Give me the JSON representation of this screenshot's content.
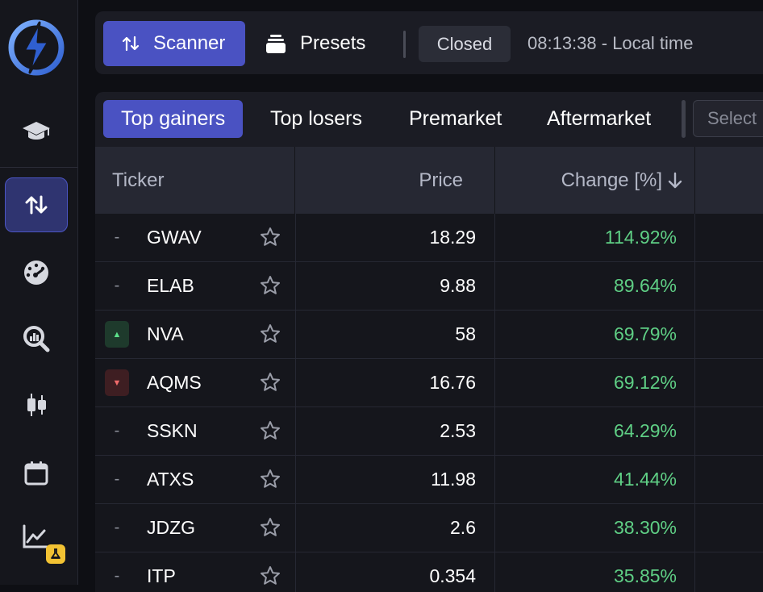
{
  "sidebar": {
    "items": [
      {
        "name": "academy",
        "icon": "graduation-cap-icon",
        "active": false
      },
      {
        "name": "scanner",
        "icon": "sort-arrows-icon",
        "active": true
      },
      {
        "name": "dashboard",
        "icon": "gauge-icon",
        "active": false
      },
      {
        "name": "research",
        "icon": "magnify-chart-icon",
        "active": false
      },
      {
        "name": "charts",
        "icon": "candlestick-icon",
        "active": false
      },
      {
        "name": "calendar",
        "icon": "calendar-icon",
        "active": false
      },
      {
        "name": "lab",
        "icon": "line-chart-icon",
        "active": false,
        "badge": "flask-icon"
      }
    ]
  },
  "topbar": {
    "scanner_label": "Scanner",
    "presets_label": "Presets",
    "market_status": "Closed",
    "local_time": "08:13:38 - Local time"
  },
  "tabs": [
    {
      "label": "Top gainers",
      "active": true
    },
    {
      "label": "Top losers",
      "active": false
    },
    {
      "label": "Premarket",
      "active": false
    },
    {
      "label": "Aftermarket",
      "active": false
    }
  ],
  "select_placeholder": "Select",
  "table": {
    "columns": {
      "ticker": "Ticker",
      "price": "Price",
      "change": "Change [%]"
    },
    "rows": [
      {
        "trend": "none",
        "trend_text": "-",
        "ticker": "GWAV",
        "price": "18.29",
        "change": "114.92%"
      },
      {
        "trend": "none",
        "trend_text": "-",
        "ticker": "ELAB",
        "price": "9.88",
        "change": "89.64%"
      },
      {
        "trend": "up",
        "trend_text": "▲",
        "ticker": "NVA",
        "price": "58",
        "change": "69.79%"
      },
      {
        "trend": "down",
        "trend_text": "▼",
        "ticker": "AQMS",
        "price": "16.76",
        "change": "69.12%"
      },
      {
        "trend": "none",
        "trend_text": "-",
        "ticker": "SSKN",
        "price": "2.53",
        "change": "64.29%"
      },
      {
        "trend": "none",
        "trend_text": "-",
        "ticker": "ATXS",
        "price": "11.98",
        "change": "41.44%"
      },
      {
        "trend": "none",
        "trend_text": "-",
        "ticker": "JDZG",
        "price": "2.6",
        "change": "38.30%"
      },
      {
        "trend": "none",
        "trend_text": "-",
        "ticker": "ITP",
        "price": "0.354",
        "change": "35.85%"
      }
    ]
  },
  "colors": {
    "accent": "#4a52c2",
    "positive": "#5fcf85",
    "up_badge": "#1e3a2c",
    "down_badge": "#3e1e22",
    "logo_blue": "#3f7be0",
    "badge_yellow": "#f2c233"
  }
}
